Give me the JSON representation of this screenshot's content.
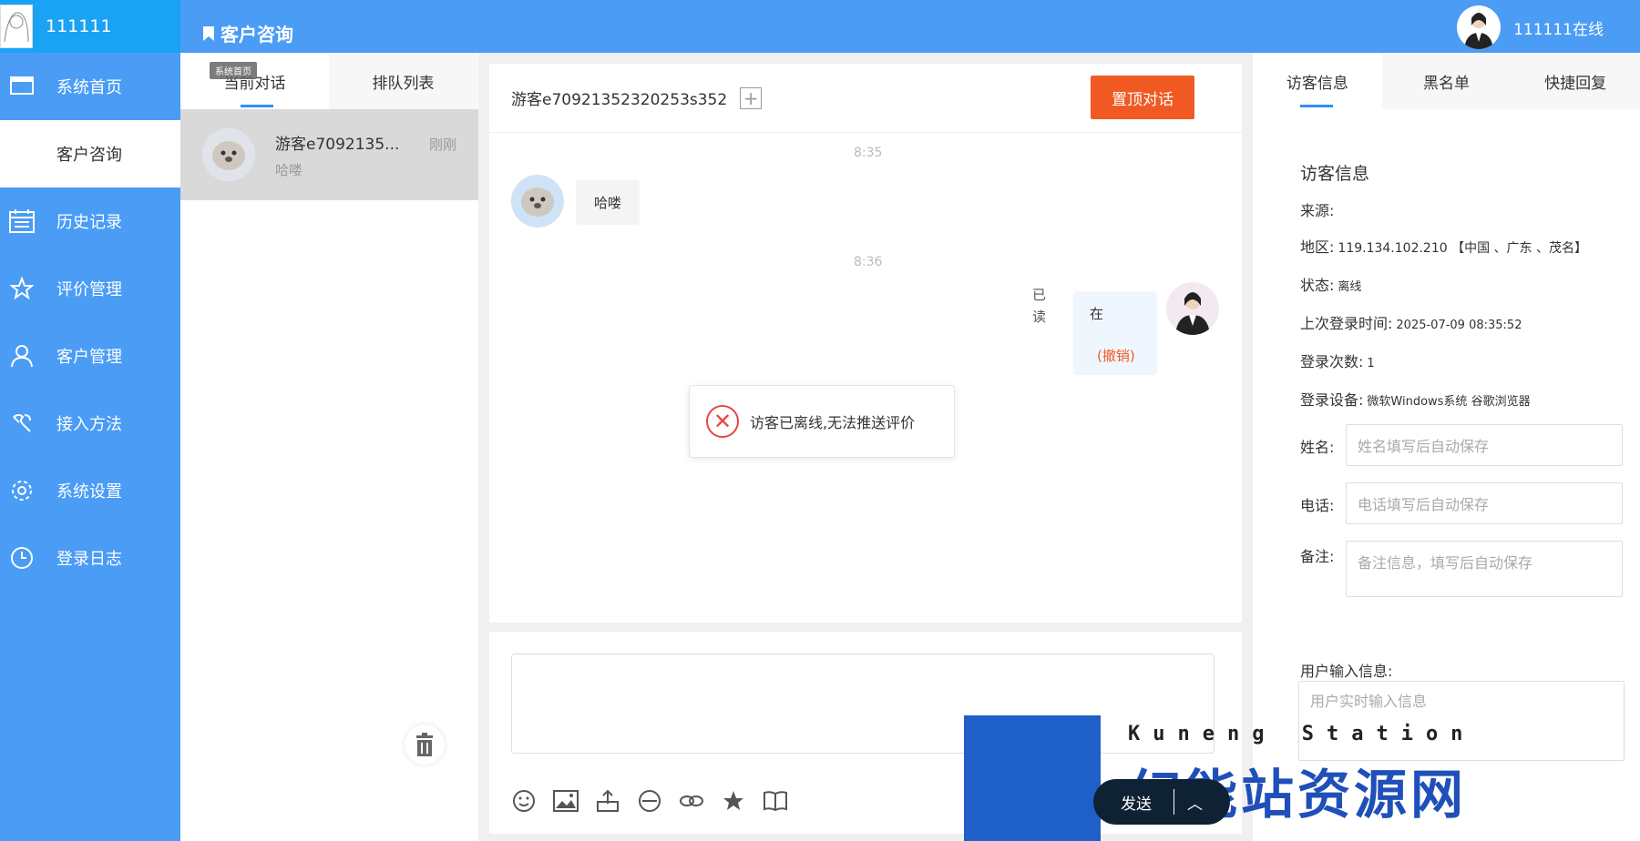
{
  "header": {
    "username": "111111",
    "page_title": "客户咨询",
    "agent_status": "111111在线"
  },
  "sidebar": {
    "items": [
      {
        "label": "系统首页",
        "icon": "monitor-icon"
      },
      {
        "label": "客户咨询",
        "icon": "chat-icon"
      },
      {
        "label": "历史记录",
        "icon": "calendar-list-icon"
      },
      {
        "label": "评价管理",
        "icon": "star-icon"
      },
      {
        "label": "客户管理",
        "icon": "user-icon"
      },
      {
        "label": "接入方法",
        "icon": "puzzle-icon"
      },
      {
        "label": "系统设置",
        "icon": "gear-icon"
      },
      {
        "label": "登录日志",
        "icon": "clock-icon"
      }
    ]
  },
  "conversations": {
    "tabs": [
      "当前对话",
      "排队列表"
    ],
    "tooltip": "系统首页",
    "items": [
      {
        "name": "游客e7092135...",
        "last_message": "哈喽",
        "time": "刚刚"
      }
    ]
  },
  "chat": {
    "visitor_name": "游客e70921352320253s352",
    "pin_button": "置顶对话",
    "messages": [
      {
        "time": "8:35",
        "text": "哈喽",
        "side": "left"
      },
      {
        "time": "8:36",
        "text": "在",
        "side": "right",
        "read_status": "已读",
        "revoke": "(撤销)"
      }
    ],
    "toast": "访客已离线,无法推送评价",
    "send_label": "发送"
  },
  "visitor_panel": {
    "tabs": [
      "访客信息",
      "黑名单",
      "快捷回复"
    ],
    "title": "访客信息",
    "source_label": "来源:",
    "source_value": "",
    "region_label": "地区:",
    "region_value": "119.134.102.210 【中国 、广东 、茂名】",
    "status_label": "状态:",
    "status_value": "离线",
    "last_login_label": "上次登录时间:",
    "last_login_value": "2025-07-09 08:35:52",
    "login_count_label": "登录次数:",
    "login_count_value": "1",
    "device_label": "登录设备:",
    "device_value": "微软Windows系统 谷歌浏览器",
    "name_label": "姓名:",
    "name_placeholder": "姓名填写后自动保存",
    "phone_label": "电话:",
    "phone_placeholder": "电话填写后自动保存",
    "note_label": "备注:",
    "note_placeholder": "备注信息，填写后自动保存",
    "user_input_label": "用户输入信息:",
    "user_input_placeholder": "用户实时输入信息"
  },
  "overlay": {
    "logo_tag": "Kuneng Station",
    "logo_text": "幻能站资源网"
  },
  "colors": {
    "primary": "#4a9cf5",
    "accent": "#f05a22",
    "error": "#e84545"
  }
}
